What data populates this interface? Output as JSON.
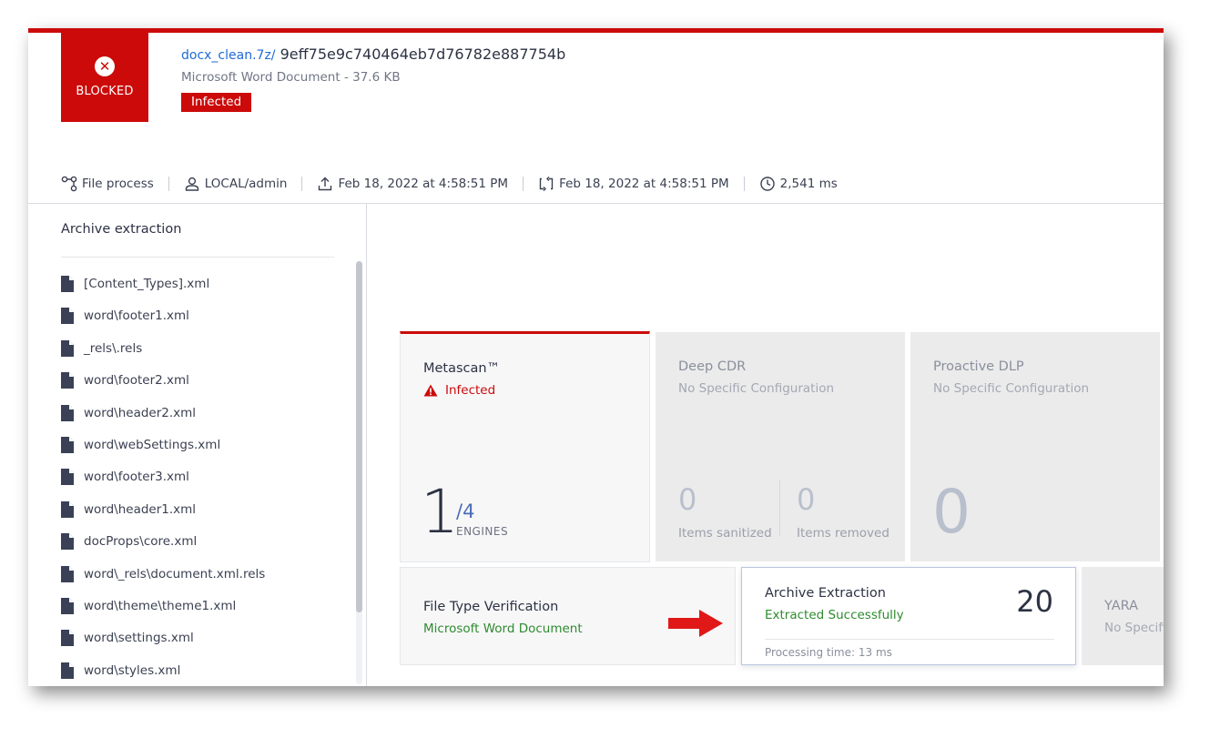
{
  "header": {
    "status_label": "BLOCKED",
    "archive_link": "docx_clean.7z/",
    "hash": "9eff75e9c740464eb7d76782e887754b",
    "file_meta": "Microsoft Word Document - 37.6 KB",
    "verdict_badge": "Infected"
  },
  "metabar": {
    "file_process": "File process",
    "user": "LOCAL/admin",
    "uploaded": "Feb 18, 2022 at 4:58:51 PM",
    "processed": "Feb 18, 2022 at 4:58:51 PM",
    "duration": "2,541 ms"
  },
  "archive_panel": {
    "title": "Archive extraction",
    "files": [
      "[Content_Types].xml",
      "word\\footer1.xml",
      "_rels\\.rels",
      "word\\footer2.xml",
      "word\\header2.xml",
      "word\\webSettings.xml",
      "word\\footer3.xml",
      "word\\header1.xml",
      "docProps\\core.xml",
      "word\\_rels\\document.xml.rels",
      "word\\theme\\theme1.xml",
      "word\\settings.xml",
      "word\\styles.xml"
    ]
  },
  "cards": {
    "metascan": {
      "title": "Metascan™",
      "status": "Infected",
      "count": "1",
      "total": "/4",
      "unit": "ENGINES"
    },
    "deep_cdr": {
      "title": "Deep CDR",
      "subtitle": "No Specific Configuration",
      "sanitized_count": "0",
      "sanitized_label": "Items sanitized",
      "removed_count": "0",
      "removed_label": "Items removed"
    },
    "proactive_dlp": {
      "title": "Proactive DLP",
      "subtitle": "No Specific Configuration",
      "count": "0"
    },
    "file_type": {
      "title": "File Type Verification",
      "result": "Microsoft Word Document"
    },
    "archive": {
      "title": "Archive Extraction",
      "result": "Extracted Successfully",
      "count": "20",
      "processing": "Processing time: 13 ms"
    },
    "yara": {
      "title": "YARA",
      "subtitle": "No Specifi"
    }
  },
  "colors": {
    "accent_red": "#cc0a0a",
    "success_green": "#2e8b2e",
    "link_blue": "#1e6bd6"
  }
}
